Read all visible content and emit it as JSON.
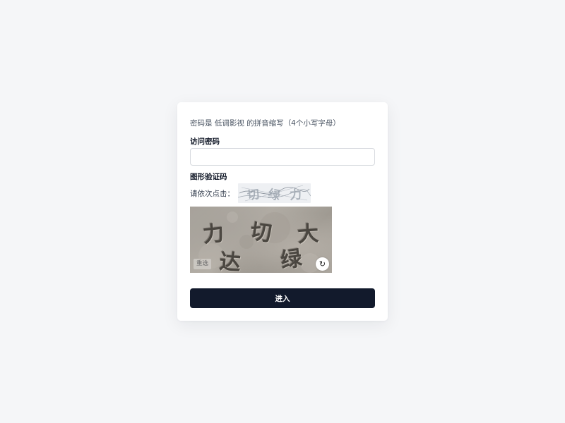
{
  "hint": "密码是 低调影视 的拼音缩写（4个小写字母）",
  "password": {
    "label": "访问密码",
    "value": "",
    "placeholder": ""
  },
  "captcha": {
    "label": "图形验证码",
    "prompt": "请依次点击：",
    "targets": [
      "切",
      "绿",
      "力"
    ],
    "chars": [
      "力",
      "切",
      "大",
      "达",
      "绿"
    ],
    "reset_label": "重选",
    "refresh_icon": "↻"
  },
  "submit_label": "进入",
  "colors": {
    "page_bg": "#f5f6f8",
    "card_bg": "#ffffff",
    "button_bg": "#121a2c",
    "button_text": "#ffffff"
  }
}
